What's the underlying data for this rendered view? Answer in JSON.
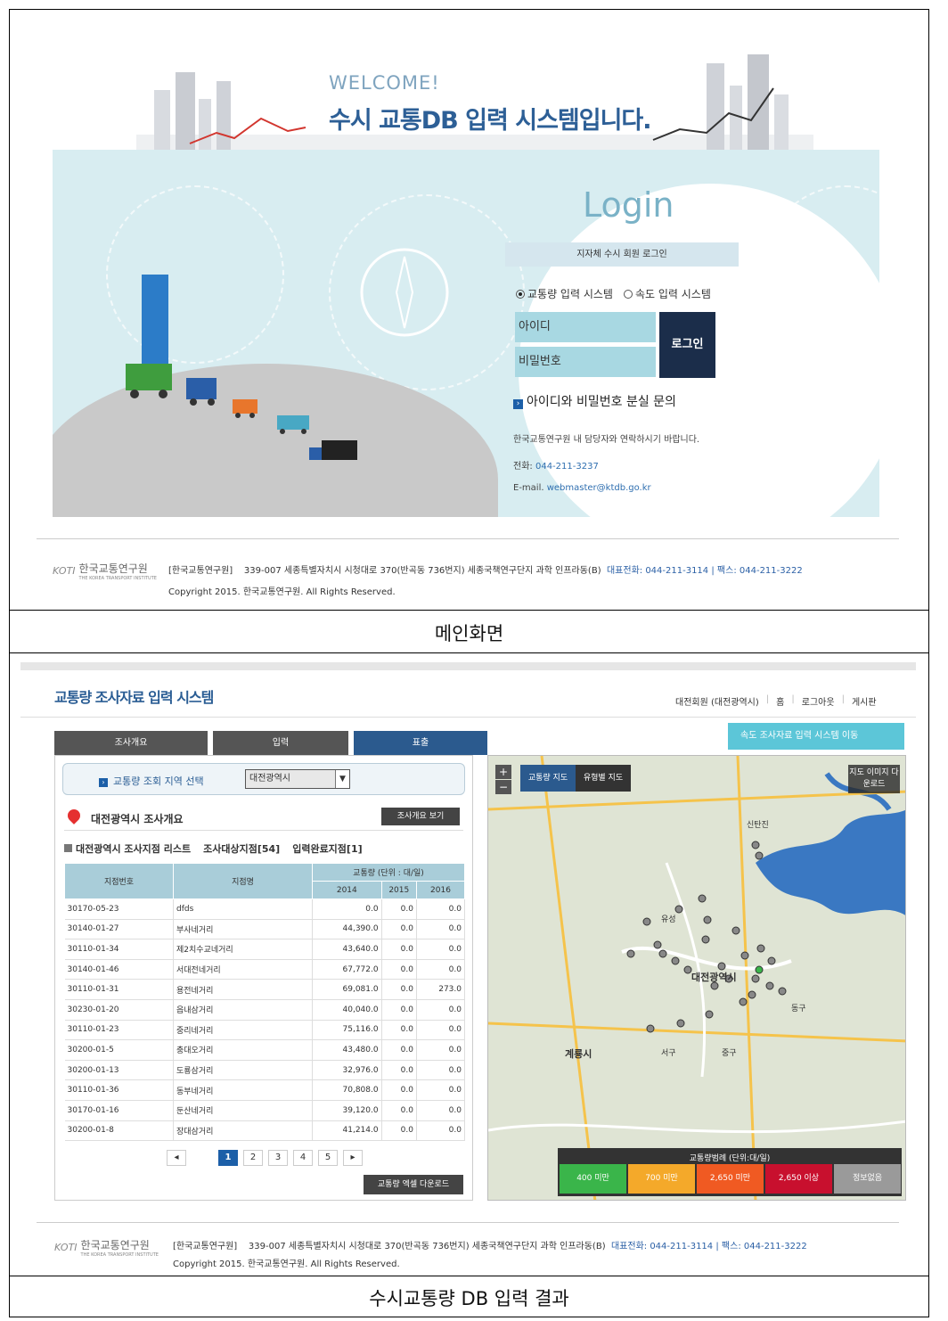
{
  "main_screen": {
    "welcome": "WELCOME!",
    "title": "수시 교통DB 입력 시스템입니다.",
    "login": {
      "title": "Login",
      "subtitle": "지자체 수시 회원 로그인",
      "radio_traffic": "교통량 입력 시스템",
      "radio_speed": "속도 입력 시스템",
      "id_placeholder": "아이디",
      "pw_placeholder": "비밀번호",
      "login_button": "로그인",
      "lost_title": "아이디와 비밀번호 분실 문의",
      "contact_text": "한국교통연구원 내 담당자와 연락하시기 바랍니다.",
      "phone_label": "전화:",
      "phone": "044-211-3237",
      "email_label": "E-mail.",
      "email": "webmaster@ktdb.go.kr"
    },
    "caption": "메인화면"
  },
  "footer": {
    "logo_ktdb": "KOTI",
    "logo_kor": "한국교통연구원",
    "logo_eng": "THE KOREA TRANSPORT INSTITUTE",
    "org": "[한국교통연구원]",
    "address": "339-007 세종특별자치시 시청대로 370(반곡동 736번지) 세종국책연구단지 과학 인프라동(B)",
    "tel": "대표전화: 044-211-3114",
    "sep": "|",
    "fax": "팩스: 044-211-3222",
    "copyright": "Copyright 2015. 한국교통연구원. All Rights Reserved."
  },
  "result_screen": {
    "title": "교통량 조사자료 입력 시스템",
    "user": "대전회원 (대전광역시)",
    "nav_home": "홈",
    "nav_logout": "로그아웃",
    "nav_board": "게시판",
    "tabs": [
      "조사개요",
      "입력",
      "표출"
    ],
    "speed_button": "속도 조사자료 입력 시스템 이동",
    "region_label": "교통량 조회 지역 선택",
    "region_value": "대전광역시",
    "overview_title": "대전광역시 조사개요",
    "overview_button": "조사개요 보기",
    "list_title": "대전광역시 조사지점 리스트",
    "target_count": "조사대상지점[54]",
    "done_count": "입력완료지점[1]",
    "table": {
      "col_id": "지점번호",
      "col_name": "지점명",
      "col_volume": "교통량 (단위 : 대/일)",
      "years": [
        "2014",
        "2015",
        "2016"
      ],
      "rows": [
        [
          "30170-05-23",
          "dfds",
          "0.0",
          "0.0",
          "0.0"
        ],
        [
          "30140-01-27",
          "부사네거리",
          "44,390.0",
          "0.0",
          "0.0"
        ],
        [
          "30110-01-34",
          "제2치수교네거리",
          "43,640.0",
          "0.0",
          "0.0"
        ],
        [
          "30140-01-46",
          "서대전네거리",
          "67,772.0",
          "0.0",
          "0.0"
        ],
        [
          "30110-01-31",
          "용전네거리",
          "69,081.0",
          "0.0",
          "273.0"
        ],
        [
          "30230-01-20",
          "읍내삼거리",
          "40,040.0",
          "0.0",
          "0.0"
        ],
        [
          "30110-01-23",
          "중리네거리",
          "75,116.0",
          "0.0",
          "0.0"
        ],
        [
          "30200-01-5",
          "충대오거리",
          "43,480.0",
          "0.0",
          "0.0"
        ],
        [
          "30200-01-13",
          "도룡삼거리",
          "32,976.0",
          "0.0",
          "0.0"
        ],
        [
          "30110-01-36",
          "동부네거리",
          "70,808.0",
          "0.0",
          "0.0"
        ],
        [
          "30170-01-16",
          "둔산네거리",
          "39,120.0",
          "0.0",
          "0.0"
        ],
        [
          "30200-01-8",
          "장대삼거리",
          "41,214.0",
          "0.0",
          "0.0"
        ]
      ]
    },
    "pager": {
      "prev": "◂",
      "pages": [
        "1",
        "2",
        "3",
        "4",
        "5"
      ],
      "next": "▸",
      "current": "1"
    },
    "excel_button": "교통량 엑셀 다운로드",
    "map": {
      "zoom_in": "+",
      "zoom_out": "−",
      "tab_traffic": "교통량 지도",
      "tab_type": "유형별 지도",
      "download": "지도 이미지 다운로드",
      "labels": {
        "daejeon": "대전광역시",
        "gyeryong": "계룡시",
        "seogu": "서구",
        "junggu": "중구",
        "donggu": "동구",
        "yuseong": "유성",
        "sintan": "신탄진"
      },
      "legend_title": "교통량범례 (단위:대/일)",
      "legend": [
        {
          "label": "400 미만",
          "color": "#3ab54a"
        },
        {
          "label": "700 미만",
          "color": "#f4a92a"
        },
        {
          "label": "2,650 미만",
          "color": "#f05a22"
        },
        {
          "label": "2,650 이상",
          "color": "#c8102e"
        },
        {
          "label": "정보없음",
          "color": "#9a9a9a"
        }
      ]
    },
    "caption": "수시교통량 DB 입력 결과"
  }
}
